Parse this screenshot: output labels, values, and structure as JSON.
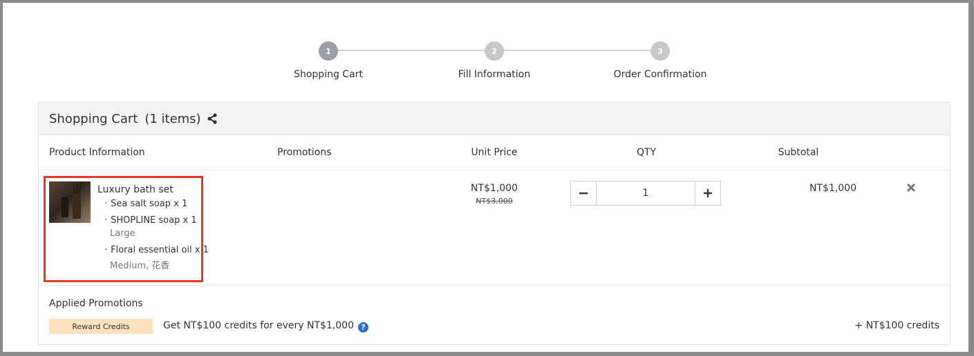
{
  "steps": [
    {
      "number": "1",
      "label": "Shopping Cart"
    },
    {
      "number": "2",
      "label": "Fill Information"
    },
    {
      "number": "3",
      "label": "Order Confirmation"
    }
  ],
  "cart": {
    "title": "Shopping Cart",
    "count": "(1 items)",
    "columns": {
      "product": "Product Information",
      "promotions": "Promotions",
      "unit_price": "Unit Price",
      "qty": "QTY",
      "subtotal": "Subtotal"
    },
    "item": {
      "name": "Luxury bath set",
      "components": [
        {
          "label": "Sea salt soap x 1",
          "variant": ""
        },
        {
          "label": "SHOPLINE soap x 1",
          "variant": "Large"
        },
        {
          "label": "Floral essential oil x 1",
          "variant": "Medium, 花香"
        }
      ],
      "price": "NT$1,000",
      "original_price": "NT$3,000",
      "qty": "1",
      "subtotal": "NT$1,000"
    }
  },
  "promotions": {
    "title": "Applied Promotions",
    "badge": "Reward Credits",
    "text": "Get NT$100 credits for every NT$1,000",
    "credits": "+ NT$100 credits",
    "help_icon": "?"
  },
  "colors": {
    "highlight": "#e5391f",
    "badge_bg": "#fde2be",
    "help_icon": "#2f6bd1"
  }
}
